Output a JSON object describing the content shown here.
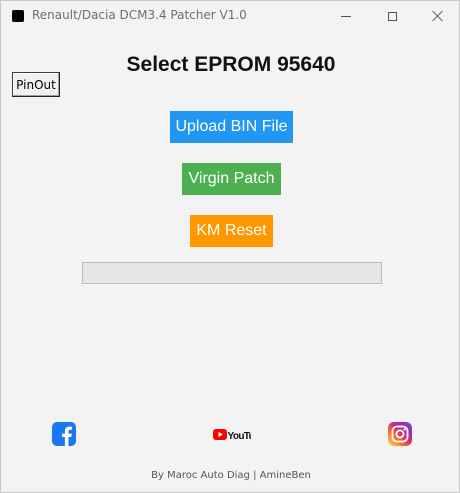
{
  "window": {
    "title": "Renault/Dacia DCM3.4 Patcher V1.0",
    "controls": [
      "minimize",
      "maximize",
      "close"
    ]
  },
  "pinout_button": {
    "label": "PinOut"
  },
  "heading": "Select EPROM 95640",
  "actions": {
    "upload": {
      "label": "Upload BIN File",
      "color": "#2196f3"
    },
    "virgin": {
      "label": "Virgin Patch",
      "color": "#4caf50"
    },
    "km_reset": {
      "label": "KM Reset",
      "color": "#ff9800"
    }
  },
  "progress": {
    "value": 0
  },
  "social": {
    "facebook_icon": "facebook-icon",
    "youtube_icon": "youtube-icon",
    "youtube_text": "YouTube",
    "instagram_icon": "instagram-icon"
  },
  "footer": "By Maroc Auto Diag | AmineBen"
}
